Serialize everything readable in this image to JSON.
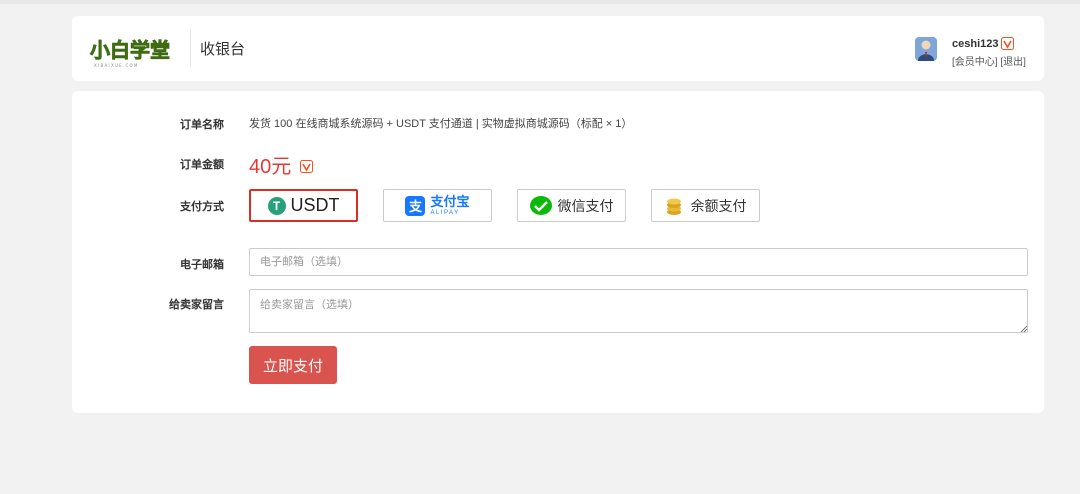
{
  "header": {
    "logo_text": "小白学堂",
    "logo_sub": "X I B A I X U E . C O M",
    "page_title": "收银台",
    "username": "ceshi123",
    "member_center": "[会员中心]",
    "logout": "[退出]"
  },
  "order": {
    "name_label": "订单名称",
    "name_value": "发货 100 在线商城系统源码 + USDT 支付通道 | 实物虚拟商城源码（标配 × 1）",
    "amount_label": "订单金额",
    "amount_value": "40元",
    "payment_label": "支付方式",
    "payment_options": [
      {
        "label": "USDT",
        "icon": "usdt-icon",
        "selected": true
      },
      {
        "label": "支付宝",
        "sub": "ALIPAY",
        "icon": "alipay-icon",
        "selected": false
      },
      {
        "label": "微信支付",
        "icon": "wechat-icon",
        "selected": false
      },
      {
        "label": "余额支付",
        "icon": "coins-icon",
        "selected": false
      }
    ],
    "email_label": "电子邮箱",
    "email_placeholder": "电子邮箱（选填）",
    "message_label": "给卖家留言",
    "message_placeholder": "给卖家留言（选填）",
    "submit_label": "立即支付"
  },
  "colors": {
    "accent_red": "#d9534f",
    "amount_red": "#e53935",
    "selected_border": "#d93025",
    "usdt_green": "#26a17b",
    "alipay_blue": "#1677ff",
    "wechat_green": "#09bb07"
  }
}
